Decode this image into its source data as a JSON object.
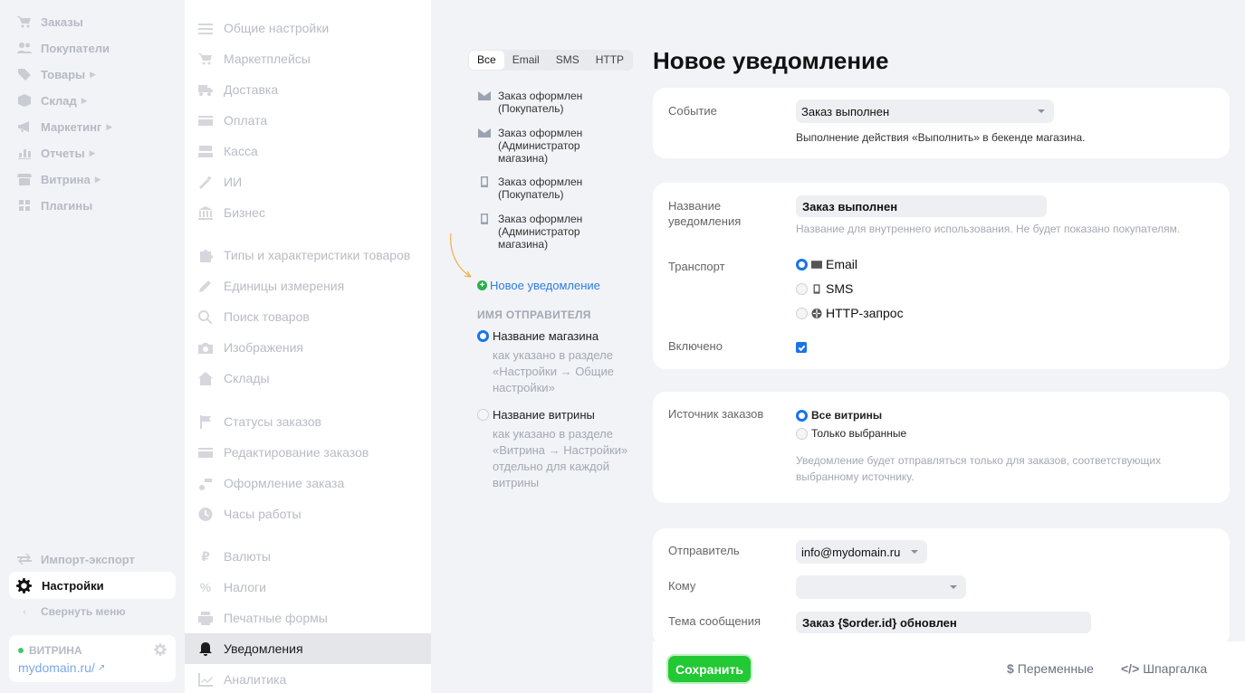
{
  "sidebar": {
    "items": [
      {
        "label": "Заказы",
        "icon": "cart-icon",
        "caret": false
      },
      {
        "label": "Покупатели",
        "icon": "users-icon",
        "caret": false
      },
      {
        "label": "Товары",
        "icon": "tag-icon",
        "caret": true
      },
      {
        "label": "Склад",
        "icon": "box-icon",
        "caret": true
      },
      {
        "label": "Маркетинг",
        "icon": "megaphone-icon",
        "caret": true
      },
      {
        "label": "Отчеты",
        "icon": "chart-icon",
        "caret": true
      },
      {
        "label": "Витрина",
        "icon": "storefront-icon",
        "caret": true
      },
      {
        "label": "Плагины",
        "icon": "plugins-icon",
        "caret": false
      }
    ],
    "import_export": "Импорт-экспорт",
    "settings": "Настройки",
    "collapse": "Свернуть меню",
    "store_label": "ВИТРИНА",
    "store_domain": "mydomain.ru/"
  },
  "settings_menu": {
    "items": [
      "Общие настройки",
      "Маркетплейсы",
      "Доставка",
      "Оплата",
      "Касса",
      "ИИ",
      "Бизнес",
      "Типы и характеристики товаров",
      "Единицы измерения",
      "Поиск товаров",
      "Изображения",
      "Склады",
      "Статусы заказов",
      "Редактирование заказов",
      "Оформление заказа",
      "Часы работы",
      "Валюты",
      "Налоги",
      "Печатные формы",
      "Уведомления",
      "Аналитика"
    ],
    "active": "Уведомления"
  },
  "notifications": {
    "tabs": [
      "Все",
      "Email",
      "SMS",
      "HTTP"
    ],
    "active_tab": "Все",
    "list": [
      {
        "label": "Заказ оформлен (Покупатель)",
        "icon": "envelope-icon"
      },
      {
        "label": "Заказ оформлен (Администратор магазина)",
        "icon": "envelope-icon"
      },
      {
        "label": "Заказ оформлен (Покупатель)",
        "icon": "phone-icon"
      },
      {
        "label": "Заказ оформлен (Администратор магазина)",
        "icon": "phone-icon"
      }
    ],
    "new_link": "Новое уведомление",
    "sender_heading": "ИМЯ ОТПРАВИТЕЛЯ",
    "sender_options": [
      {
        "label": "Название магазина",
        "hint": "как указано в разделе «Настройки → Общие настройки»",
        "selected": true
      },
      {
        "label": "Название витрины",
        "hint": "как указано в разделе «Витрина → Настройки» отдельно для каждой витрины",
        "selected": false
      }
    ]
  },
  "form": {
    "title": "Новое уведомление",
    "event_label": "Событие",
    "event_value": "Заказ выполнен",
    "event_desc": "Выполнение действия «Выполнить» в бекенде магазина.",
    "name_label": "Название уведомления",
    "name_value": "Заказ выполнен",
    "name_desc": "Название для внутреннего использования. Не будет показано покупателям.",
    "transport_label": "Транспорт",
    "transports": [
      {
        "label": "Email",
        "icon": "envelope-icon",
        "selected": true
      },
      {
        "label": "SMS",
        "icon": "phone-icon",
        "selected": false
      },
      {
        "label": "HTTP-запрос",
        "icon": "globe-icon",
        "selected": false
      }
    ],
    "enabled_label": "Включено",
    "enabled": true,
    "source_label": "Источник заказов",
    "sources": [
      {
        "label": "Все витрины",
        "selected": true
      },
      {
        "label": "Только выбранные",
        "selected": false
      }
    ],
    "source_desc": "Уведомление будет отправляться только для заказов, соответствующих выбранному источнику.",
    "sender_label": "Отправитель",
    "sender_value": "info@mydomain.ru",
    "to_label": "Кому",
    "to_value": "",
    "subject_label": "Тема сообщения",
    "subject_value": "Заказ {$order.id} обновлен"
  },
  "footer": {
    "save": "Сохранить",
    "variables": "Переменные",
    "cheatsheet": "Шпаргалка"
  },
  "colors": {
    "accent": "#1a73e8",
    "save": "#22c934",
    "link": "#2d7de0"
  }
}
